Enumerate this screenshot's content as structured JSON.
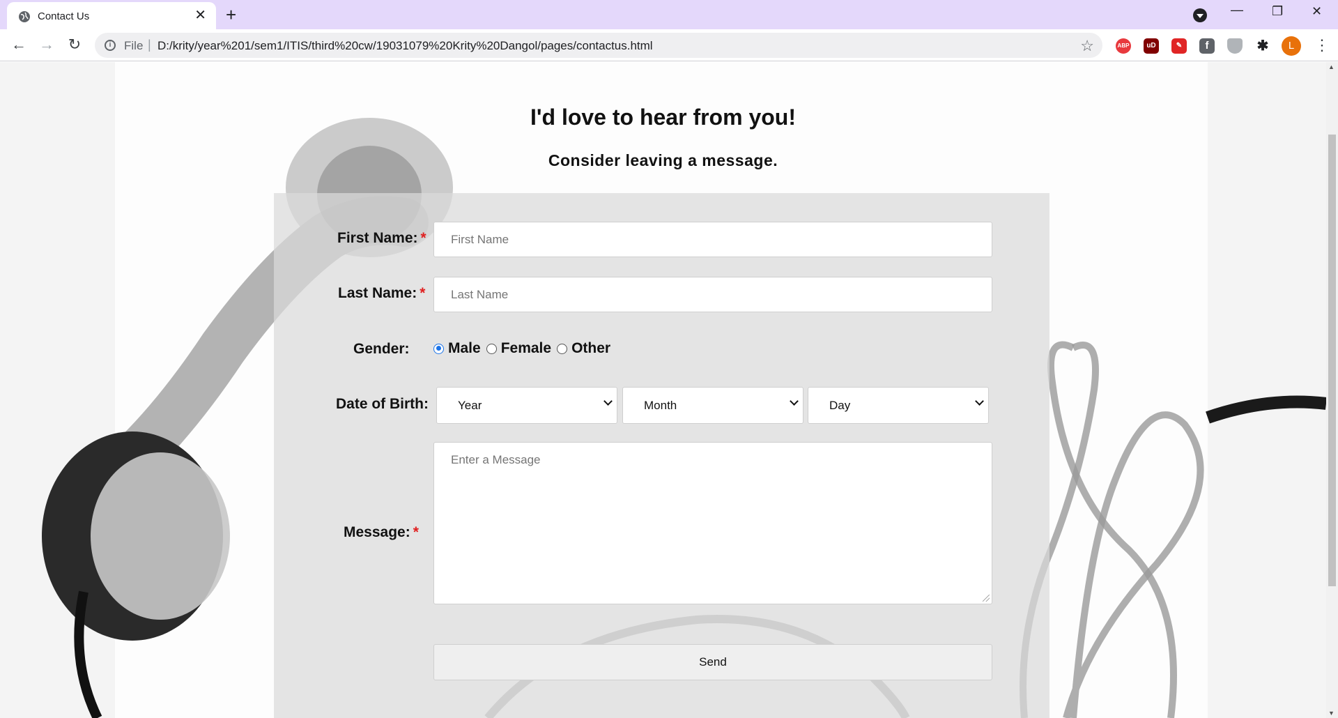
{
  "browser": {
    "tab_title": "Contact Us",
    "tab_close": "✕",
    "new_tab": "+",
    "address_prefix": "File",
    "address_separator": "|",
    "url": "D:/krity/year%201/sem1/ITIS/third%20cw/19031079%20Krity%20Dangol/pages/contactus.html",
    "profile_initial": "L",
    "extensions": [
      {
        "name": "adblock-plus-icon",
        "label": "ABP",
        "color": "#e8393e"
      },
      {
        "name": "ublock-icon",
        "label": "uD",
        "color": "#800000"
      },
      {
        "name": "pdf-icon",
        "label": "✎",
        "color": "#e02525"
      },
      {
        "name": "facebook-icon",
        "label": "f",
        "color": "#5f6368"
      },
      {
        "name": "shield-icon",
        "label": "",
        "color": "#9aa0a6"
      }
    ],
    "accent_tabbar": "#e4d8fb"
  },
  "page": {
    "heading": "I'd love to hear from you!",
    "subheading": "Consider leaving a message."
  },
  "form": {
    "first_name": {
      "label": "First Name:",
      "required_mark": "*",
      "placeholder": "First Name",
      "value": ""
    },
    "last_name": {
      "label": "Last Name:",
      "required_mark": "*",
      "placeholder": "Last Name",
      "value": ""
    },
    "gender": {
      "label": "Gender:",
      "options": [
        "Male",
        "Female",
        "Other"
      ],
      "selected": "Male"
    },
    "dob": {
      "label": "Date of Birth:",
      "year": "Year",
      "month": "Month",
      "day": "Day"
    },
    "message": {
      "label": "Message:",
      "required_mark": "*",
      "placeholder": "Enter a Message",
      "value": ""
    },
    "send_label": "Send"
  }
}
